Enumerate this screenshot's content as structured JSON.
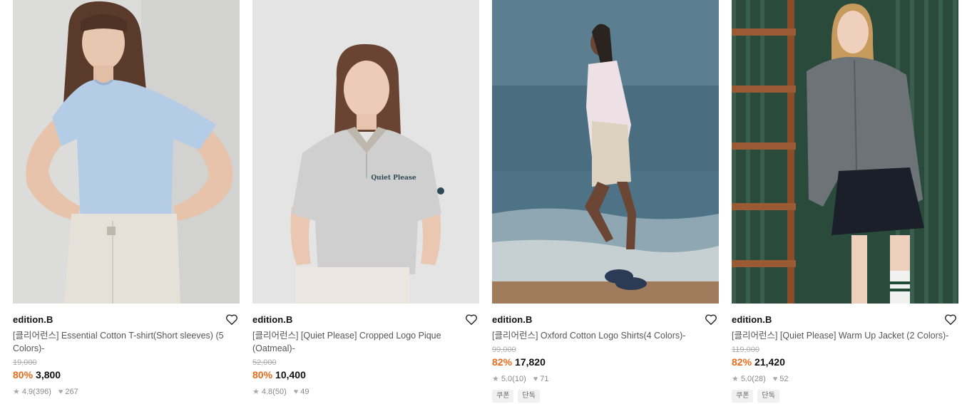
{
  "products": [
    {
      "brand": "edition.B",
      "name": "[클리어런스] Essential Cotton T-shirt(Short sleeves) (5 Colors)-",
      "original_price": "19,000",
      "discount": "80%",
      "price": "3,800",
      "rating": "4.9",
      "reviews": "(396)",
      "likes": "267",
      "tags": []
    },
    {
      "brand": "edition.B",
      "name": "[클리어런스] [Quiet Please] Cropped Logo Pique (Oatmeal)-",
      "original_price": "52,000",
      "discount": "80%",
      "price": "10,400",
      "rating": "4.8",
      "reviews": "(50)",
      "likes": "49",
      "tags": []
    },
    {
      "brand": "edition.B",
      "name": "[클리어런스] Oxford Cotton Logo Shirts(4 Colors)-",
      "original_price": "99,000",
      "discount": "82%",
      "price": "17,820",
      "rating": "5.0",
      "reviews": "(10)",
      "likes": "71",
      "tags": [
        "쿠폰",
        "단독"
      ]
    },
    {
      "brand": "edition.B",
      "name": "[클리어런스] [Quiet Please] Warm Up Jacket (2 Colors)-",
      "original_price": "119,000",
      "discount": "82%",
      "price": "21,420",
      "rating": "5.0",
      "reviews": "(28)",
      "likes": "52",
      "tags": [
        "쿠폰",
        "단독"
      ]
    }
  ],
  "photo_print": {
    "shirt_logo": "Quiet Please"
  },
  "colors": {
    "discount": "#ea6b1a",
    "original_price": "#aaaaaa",
    "name_text": "#555555"
  }
}
